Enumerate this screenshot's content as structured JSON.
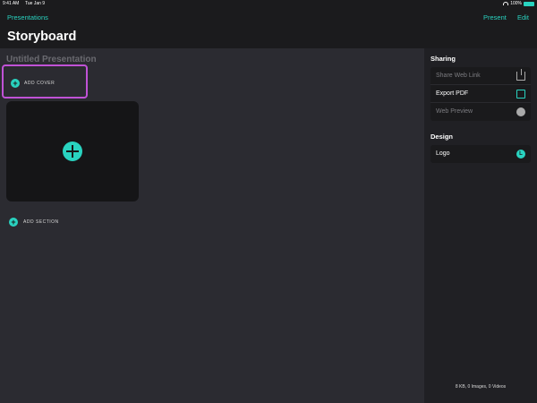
{
  "status_bar": {
    "time": "9:41 AM",
    "date": "Tue Jan 9",
    "battery": "100%"
  },
  "nav": {
    "back_label": "Presentations",
    "present_label": "Present",
    "edit_label": "Edit",
    "title": "Storyboard"
  },
  "main": {
    "presentation_title": "Untitled Presentation",
    "add_cover_label": "ADD COVER",
    "add_section_label": "ADD SECTION"
  },
  "sidebar": {
    "sharing_header": "Sharing",
    "sharing_items": [
      {
        "label": "Share Web Link",
        "enabled": false,
        "icon": "share-icon"
      },
      {
        "label": "Export PDF",
        "enabled": true,
        "icon": "pdf-icon"
      },
      {
        "label": "Web Preview",
        "enabled": false,
        "icon": "compass-icon"
      }
    ],
    "design_header": "Design",
    "design_items": [
      {
        "label": "Logo",
        "enabled": true,
        "icon": "logo-icon"
      }
    ],
    "footer": "8 KB, 0 Images, 0 Videos"
  },
  "colors": {
    "accent": "#29d3c0",
    "highlight": "#c052d6",
    "background": "#2b2b31",
    "sidebar": "#202024"
  }
}
